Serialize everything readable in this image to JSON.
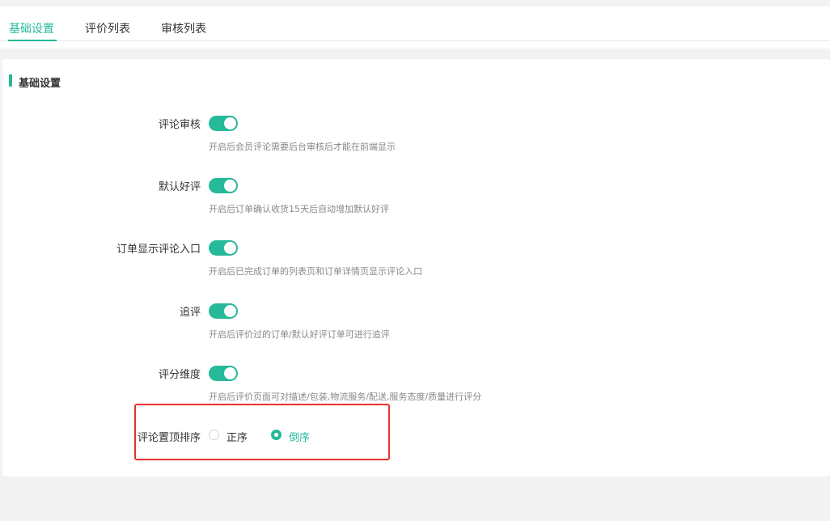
{
  "tabs": [
    {
      "label": "基础设置",
      "active": true
    },
    {
      "label": "评价列表",
      "active": false
    },
    {
      "label": "审核列表",
      "active": false
    }
  ],
  "section": {
    "title": "基础设置"
  },
  "settings": [
    {
      "label": "评论审核",
      "enabled": true,
      "hint": "开启后会员评论需要后台审核后才能在前端显示"
    },
    {
      "label": "默认好评",
      "enabled": true,
      "hint": "开启后订单确认收货15天后自动增加默认好评"
    },
    {
      "label": "订单显示评论入口",
      "enabled": true,
      "hint": "开启后已完成订单的列表页和订单详情页显示评论入口"
    },
    {
      "label": "追评",
      "enabled": true,
      "hint": "开启后评价过的订单/默认好评订单可进行追评"
    },
    {
      "label": "评分维度",
      "enabled": true,
      "hint": "开启后评价页面可对描述/包装,物流服务/配送,服务态度/质量进行评分"
    }
  ],
  "sort_setting": {
    "label": "评论置顶排序",
    "options": [
      {
        "label": "正序",
        "checked": false
      },
      {
        "label": "倒序",
        "checked": true
      }
    ]
  },
  "colors": {
    "accent": "#26b99a",
    "highlight": "#e8312a"
  }
}
